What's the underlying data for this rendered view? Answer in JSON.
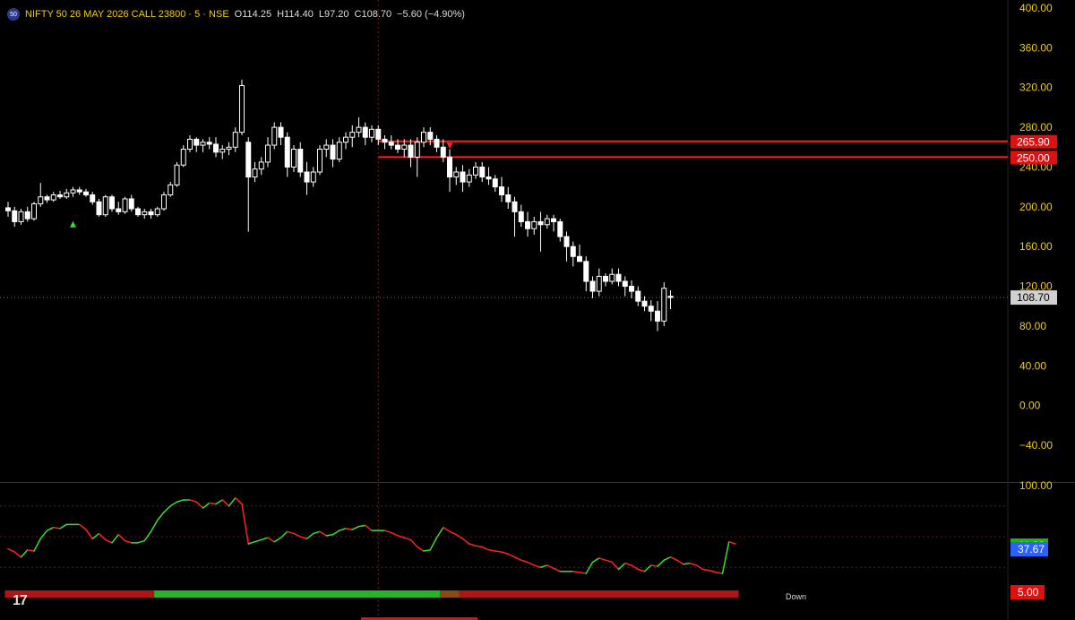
{
  "header": {
    "badge": "50",
    "title": "NIFTY 50 26 MAY 2026 CALL 23800 · 5 · NSE",
    "open_label": "O",
    "open": "114.25",
    "high_label": "H",
    "high": "114.40",
    "low_label": "L",
    "low": "97.20",
    "close_label": "C",
    "close": "108.70",
    "change": "−5.60 (−4.90%)"
  },
  "colors": {
    "axis_text": "#f0d000",
    "candle": "#ffffff",
    "level_line": "#ff1e1e",
    "osc_up": "#34e034",
    "osc_down": "#ff2020",
    "label_green": "#1db31d",
    "label_blue": "#2962ff",
    "label_red": "#e01010"
  },
  "chart_data": [
    {
      "type": "candlestick",
      "ylim": [
        -60,
        400
      ],
      "y_ticks": [
        "400.00",
        "360.00",
        "320.00",
        "280.00",
        "240.00",
        "200.00",
        "160.00",
        "120.00",
        "80.00",
        "40.00",
        "0.00",
        "−40.00"
      ],
      "y_tick_values": [
        400,
        360,
        320,
        280,
        240,
        200,
        160,
        120,
        80,
        40,
        0,
        -40
      ],
      "last_price": 108.7,
      "last_price_label": "108.70",
      "levels": [
        {
          "value": 265.9,
          "label": "265.90",
          "start_index": 57
        },
        {
          "value": 250.0,
          "label": "250.00",
          "start_index": 57
        }
      ],
      "markers": [
        {
          "type": "up-triangle",
          "index": 10,
          "value": 182,
          "color": "#34e034"
        },
        {
          "type": "down-triangle",
          "index": 68,
          "value": 262,
          "color": "#ff2020"
        }
      ],
      "crosshair_index": 57,
      "candles": [
        [
          199,
          205,
          190,
          196
        ],
        [
          196,
          200,
          180,
          185
        ],
        [
          185,
          198,
          182,
          195
        ],
        [
          195,
          200,
          185,
          188
        ],
        [
          188,
          205,
          186,
          203
        ],
        [
          203,
          224,
          200,
          210
        ],
        [
          210,
          212,
          204,
          207
        ],
        [
          207,
          215,
          205,
          212
        ],
        [
          212,
          216,
          208,
          210
        ],
        [
          210,
          218,
          208,
          214
        ],
        [
          214,
          220,
          210,
          217
        ],
        [
          217,
          220,
          212,
          215
        ],
        [
          215,
          218,
          210,
          212
        ],
        [
          212,
          215,
          202,
          205
        ],
        [
          205,
          208,
          190,
          192
        ],
        [
          192,
          212,
          190,
          210
        ],
        [
          210,
          212,
          195,
          198
        ],
        [
          198,
          205,
          192,
          195
        ],
        [
          195,
          210,
          193,
          208
        ],
        [
          208,
          212,
          195,
          198
        ],
        [
          198,
          200,
          190,
          192
        ],
        [
          192,
          198,
          188,
          195
        ],
        [
          195,
          198,
          188,
          192
        ],
        [
          192,
          200,
          190,
          198
        ],
        [
          198,
          215,
          196,
          212
        ],
        [
          212,
          225,
          210,
          222
        ],
        [
          222,
          245,
          220,
          242
        ],
        [
          242,
          262,
          240,
          258
        ],
        [
          258,
          272,
          255,
          268
        ],
        [
          268,
          270,
          255,
          262
        ],
        [
          262,
          268,
          255,
          265
        ],
        [
          265,
          270,
          258,
          263
        ],
        [
          263,
          270,
          250,
          255
        ],
        [
          255,
          262,
          248,
          258
        ],
        [
          258,
          265,
          252,
          260
        ],
        [
          260,
          280,
          255,
          275
        ],
        [
          275,
          328,
          272,
          322
        ],
        [
          265,
          270,
          175,
          230
        ],
        [
          230,
          245,
          225,
          238
        ],
        [
          238,
          250,
          232,
          245
        ],
        [
          245,
          270,
          240,
          262
        ],
        [
          262,
          285,
          258,
          280
        ],
        [
          280,
          285,
          262,
          270
        ],
        [
          270,
          275,
          230,
          240
        ],
        [
          240,
          262,
          235,
          258
        ],
        [
          258,
          265,
          230,
          235
        ],
        [
          235,
          245,
          212,
          225
        ],
        [
          225,
          240,
          220,
          235
        ],
        [
          235,
          262,
          232,
          258
        ],
        [
          258,
          268,
          250,
          262
        ],
        [
          262,
          268,
          240,
          248
        ],
        [
          248,
          270,
          245,
          265
        ],
        [
          265,
          275,
          258,
          270
        ],
        [
          270,
          282,
          260,
          275
        ],
        [
          275,
          290,
          270,
          280
        ],
        [
          280,
          285,
          262,
          270
        ],
        [
          270,
          282,
          265,
          278
        ],
        [
          278,
          282,
          262,
          268
        ],
        [
          268,
          272,
          258,
          265
        ],
        [
          265,
          272,
          258,
          262
        ],
        [
          262,
          268,
          254,
          258
        ],
        [
          258,
          268,
          250,
          262
        ],
        [
          262,
          268,
          240,
          250
        ],
        [
          250,
          270,
          230,
          265
        ],
        [
          265,
          280,
          260,
          275
        ],
        [
          275,
          280,
          262,
          268
        ],
        [
          268,
          272,
          255,
          260
        ],
        [
          260,
          268,
          245,
          250
        ],
        [
          250,
          258,
          215,
          230
        ],
        [
          230,
          240,
          222,
          235
        ],
        [
          235,
          242,
          215,
          225
        ],
        [
          225,
          238,
          220,
          232
        ],
        [
          232,
          245,
          228,
          240
        ],
        [
          240,
          245,
          225,
          230
        ],
        [
          230,
          240,
          222,
          228
        ],
        [
          228,
          232,
          215,
          220
        ],
        [
          220,
          230,
          205,
          212
        ],
        [
          212,
          220,
          198,
          205
        ],
        [
          205,
          210,
          170,
          195
        ],
        [
          195,
          202,
          180,
          185
        ],
        [
          185,
          195,
          170,
          178
        ],
        [
          178,
          190,
          172,
          185
        ],
        [
          185,
          195,
          155,
          182
        ],
        [
          182,
          192,
          178,
          188
        ],
        [
          188,
          192,
          175,
          185
        ],
        [
          185,
          188,
          165,
          170
        ],
        [
          170,
          175,
          145,
          160
        ],
        [
          160,
          165,
          140,
          150
        ],
        [
          150,
          162,
          145,
          145
        ],
        [
          145,
          150,
          115,
          125
        ],
        [
          125,
          130,
          108,
          115
        ],
        [
          115,
          138,
          110,
          130
        ],
        [
          130,
          133,
          120,
          125
        ],
        [
          125,
          138,
          122,
          132
        ],
        [
          132,
          138,
          120,
          125
        ],
        [
          125,
          130,
          110,
          120
        ],
        [
          120,
          126,
          108,
          115
        ],
        [
          115,
          120,
          100,
          105
        ],
        [
          105,
          110,
          95,
          100
        ],
        [
          100,
          106,
          85,
          95
        ],
        [
          95,
          105,
          75,
          85
        ],
        [
          85,
          124,
          80,
          118
        ],
        [
          110,
          116,
          97,
          108.7
        ]
      ]
    },
    {
      "type": "line",
      "name": "oscillator",
      "ylim": [
        0,
        100
      ],
      "y_ticks": [
        "100.00"
      ],
      "y_tick_values": [
        100
      ],
      "values": [
        38,
        35,
        30,
        37,
        36,
        48,
        56,
        59,
        58,
        62,
        62,
        62,
        57,
        48,
        53,
        47,
        44,
        52,
        46,
        44,
        44,
        46,
        55,
        66,
        74,
        80,
        84,
        86,
        86,
        84,
        78,
        83,
        82,
        86,
        80,
        88,
        82,
        43,
        45,
        47,
        49,
        45,
        49,
        55,
        53,
        50,
        48,
        53,
        55,
        51,
        52,
        56,
        58,
        57,
        60,
        61,
        56,
        56,
        56,
        54,
        51,
        49,
        47,
        40,
        36,
        37,
        49,
        59,
        55,
        52,
        48,
        43,
        41,
        40,
        37,
        36,
        35,
        33,
        30,
        27,
        25,
        22,
        20,
        22,
        19,
        16,
        16,
        16,
        15,
        14,
        25,
        29,
        27,
        25,
        18,
        24,
        22,
        18,
        16,
        22,
        21,
        27,
        30,
        27,
        23,
        24,
        22,
        18,
        17,
        15,
        14,
        45,
        43
      ],
      "current_value": 41.22,
      "current_label": "41.22",
      "signal_value": 37.67,
      "signal_label": "37.67",
      "reference_lines": [
        80,
        50,
        20
      ],
      "bar_segments": [
        {
          "from": 0,
          "to": 23,
          "color": "#b01414"
        },
        {
          "from": 23,
          "to": 67,
          "color": "#28b428"
        },
        {
          "from": 67,
          "to": 70,
          "color": "#8a4a14"
        },
        {
          "from": 70,
          "to": 113,
          "color": "#b01414"
        }
      ],
      "bar_value_label": "5.00",
      "state_label": "Down"
    }
  ],
  "logo": {
    "text": "17"
  }
}
